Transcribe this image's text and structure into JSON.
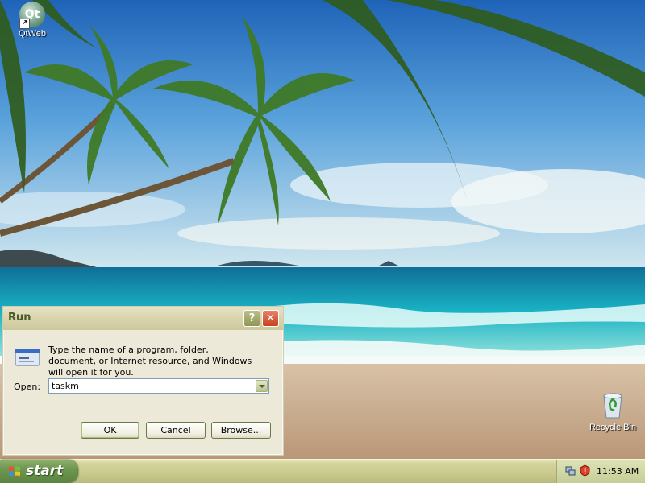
{
  "desktop": {
    "icons": [
      {
        "label": "QtWeb",
        "icon": "qtweb-icon"
      },
      {
        "label": "Recycle Bin",
        "icon": "recycle-bin-icon"
      }
    ]
  },
  "run_dialog": {
    "title": "Run",
    "help_button": "?",
    "close_button": "✕",
    "description": "Type the name of a program, folder, document, or Internet resource, and Windows will open it for you.",
    "open_label": "Open:",
    "open_value": "taskm",
    "ok_label": "OK",
    "cancel_label": "Cancel",
    "browse_label": "Browse..."
  },
  "taskbar": {
    "start_label": "start",
    "clock": "11:53 AM",
    "tray_icons": [
      "network-icon",
      "security-alert-icon"
    ]
  },
  "colors": {
    "taskbar": "#c8c98d",
    "start_button": "#6d9650",
    "dialog_title": "#4b5a2c"
  }
}
